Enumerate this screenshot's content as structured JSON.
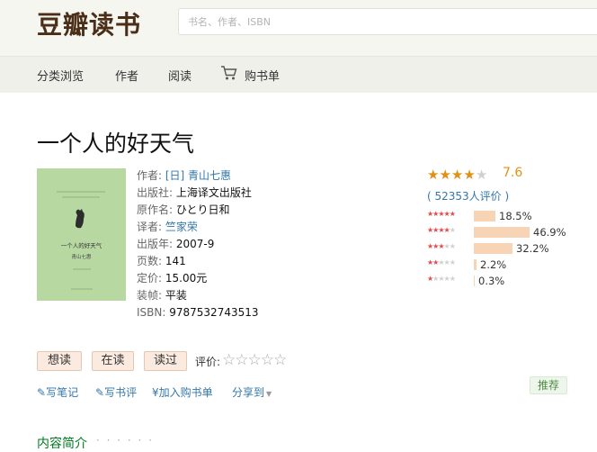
{
  "header": {
    "logo": "豆瓣读书",
    "search_placeholder": "书名、作者、ISBN"
  },
  "nav": {
    "items": [
      "分类浏览",
      "作者",
      "阅读",
      "购书单"
    ],
    "cart_icon": "cart-icon"
  },
  "book": {
    "title": "一个人的好天气",
    "cover_text": [
      "一个人的好天气",
      "青山七惠"
    ],
    "author_label": "作者:",
    "author_value": "[日] 青山七惠",
    "publisher_label": "出版社:",
    "publisher_value": "上海译文出版社",
    "original_label": "原作名:",
    "original_value": "ひとり日和",
    "translator_label": "译者:",
    "translator_value": "竺家荣",
    "year_label": "出版年:",
    "year_value": "2007-9",
    "pages_label": "页数:",
    "pages_value": "141",
    "price_label": "定价:",
    "price_value": "15.00元",
    "binding_label": "装帧:",
    "binding_value": "平装",
    "isbn_label": "ISBN:",
    "isbn_value": "9787532743513"
  },
  "rating": {
    "score": "7.6",
    "stars_filled": 4,
    "votes_text": "( 52353人评价 )",
    "distribution": [
      {
        "stars": 5,
        "fraction": 0.185,
        "label": "18.5%"
      },
      {
        "stars": 4,
        "fraction": 0.469,
        "label": "46.9%"
      },
      {
        "stars": 3,
        "fraction": 0.322,
        "label": "32.2%"
      },
      {
        "stars": 2,
        "fraction": 0.022,
        "label": "2.2%"
      },
      {
        "stars": 1,
        "fraction": 0.003,
        "label": "0.3%"
      }
    ],
    "colors": {
      "star": "#e09015",
      "star_empty": "#d0d0d0",
      "bar": "#f7d4b5"
    }
  },
  "actions": {
    "want": "想读",
    "reading": "在读",
    "read": "读过",
    "rate_label": "评价:",
    "rate_stars": "☆☆☆☆☆",
    "write_note": "写笔记",
    "write_review": "写书评",
    "add_cart": "加入购书单",
    "share": "分享到",
    "recommend": "推荐"
  },
  "section": {
    "title": "内容简介",
    "dots": "· · · · · ·"
  }
}
